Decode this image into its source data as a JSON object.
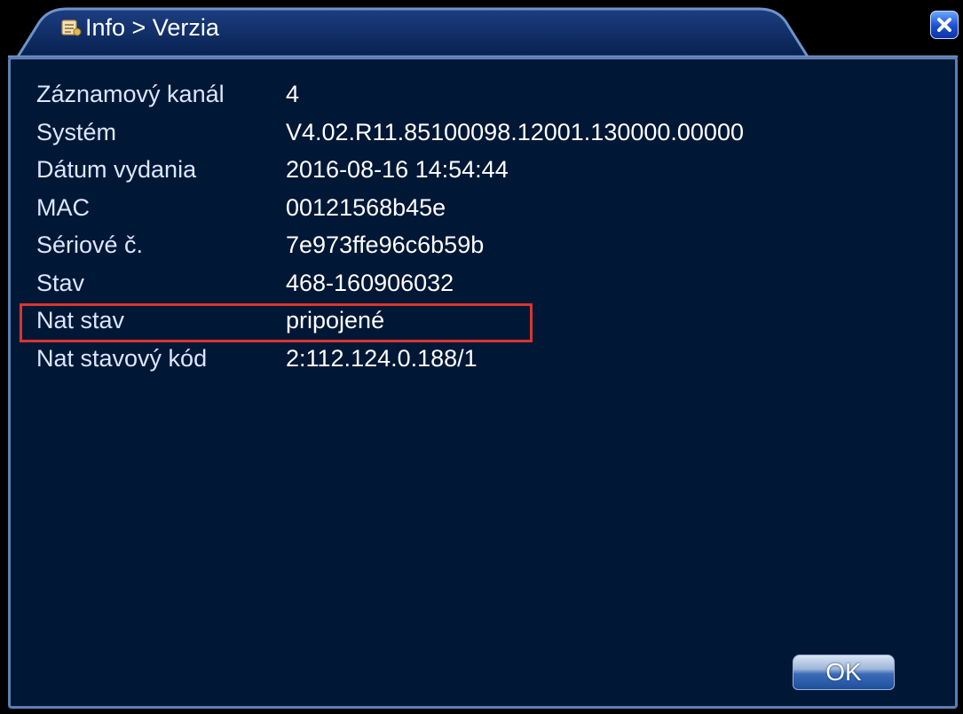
{
  "window": {
    "title": "Info > Verzia",
    "title_icon": "info-icon",
    "close_icon": "close-icon"
  },
  "info": {
    "rows": [
      {
        "label": "Záznamový kanál",
        "value": "4"
      },
      {
        "label": "Systém",
        "value": "V4.02.R11.85100098.12001.130000.00000"
      },
      {
        "label": "Dátum vydania",
        "value": "2016-08-16 14:54:44"
      },
      {
        "label": "MAC",
        "value": "00121568b45e"
      },
      {
        "label": "Sériové č.",
        "value": "7e973ffe96c6b59b"
      },
      {
        "label": "Stav",
        "value": "468-160906032"
      },
      {
        "label": "Nat stav",
        "value": "pripojené"
      },
      {
        "label": "Nat stavový kód",
        "value": "2:112.124.0.188/1"
      }
    ],
    "highlighted_row": "Nat stav"
  },
  "footer": {
    "ok_label": "OK"
  },
  "colors": {
    "panel_bg": "#001736",
    "panel_border": "#5c7fb4",
    "title_tab": "#0a2a66",
    "highlight": "#d9352f",
    "label_text": "#dbe6ff",
    "value_text": "#ffffff"
  }
}
